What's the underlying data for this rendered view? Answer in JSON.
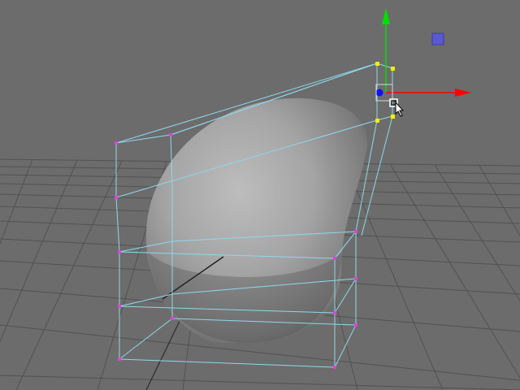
{
  "viewport": {
    "view": "perspective",
    "background_color": "#6c6c6c",
    "grid_color": "#525252",
    "grid_axis_color": "#2c2c2c"
  },
  "object": {
    "shape": "egg",
    "shading": "smooth-gray",
    "selected": false
  },
  "lattice": {
    "wireframe_color": "#8fd8ec",
    "point_color": "#e040e0",
    "selected_point_color": "#f0f000"
  },
  "manipulator": {
    "tool": "move",
    "x_axis_color": "#ff0000",
    "y_axis_color": "#00e000",
    "z_axis_color": "#1010ff",
    "plane_handle_color": "#5a5ad0"
  },
  "cursor": {
    "icon": "arrow-cursor-icon"
  }
}
